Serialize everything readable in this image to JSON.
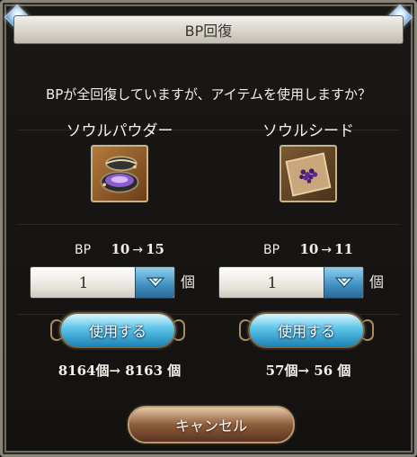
{
  "dialog": {
    "title": "BP回復",
    "question": "BPが全回復していますが、アイテムを使用しますか？"
  },
  "items": [
    {
      "name": "ソウルパウダー",
      "icon": "soul-powder-icon",
      "bp_label": "BP",
      "bp_from": "10",
      "arrow": "→",
      "bp_to": "15",
      "qty_value": "1",
      "qty_unit": "個",
      "use_label": "使用する",
      "count_text": "8164個→ 8163 個"
    },
    {
      "name": "ソウルシード",
      "icon": "soul-seed-icon",
      "bp_label": "BP",
      "bp_from": "10",
      "arrow": "→",
      "bp_to": "11",
      "qty_value": "1",
      "qty_unit": "個",
      "use_label": "使用する",
      "count_text": "57個→ 56 個"
    }
  ],
  "cancel_label": "キャンセル",
  "colors": {
    "title_bar": "#d8d4cc",
    "use_button": "#5cc3e8",
    "cancel_button": "#8e5d3b",
    "text": "#f4f0e8"
  }
}
